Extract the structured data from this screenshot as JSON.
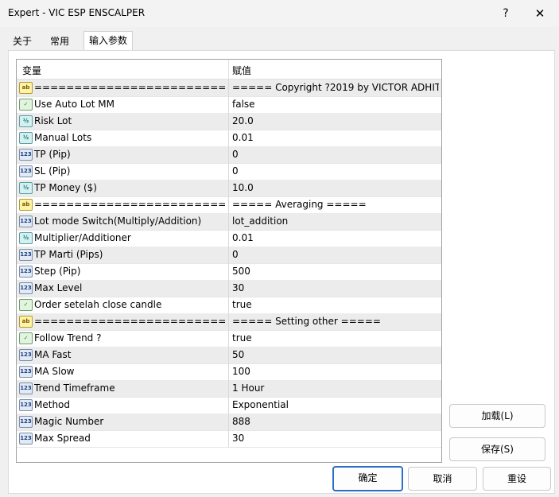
{
  "window": {
    "title": "Expert - VIC ESP ENSCALPER",
    "help_label": "?",
    "close_label": "✕"
  },
  "tabs": [
    {
      "label": "关于"
    },
    {
      "label": "常用"
    },
    {
      "label": "输入参数"
    }
  ],
  "grid": {
    "col_variable": "变量",
    "col_value": "赋值",
    "rows": [
      {
        "icon": "ab",
        "icon_name": "string-type-icon",
        "name": "=========================...",
        "value": "===== Copyright ?2019 by VICTOR ADHIT..."
      },
      {
        "icon": "bool",
        "icon_name": "boolean-type-icon",
        "name": "Use Auto Lot MM",
        "value": "false"
      },
      {
        "icon": "v2",
        "icon_name": "double-type-icon",
        "name": "Risk Lot",
        "value": "20.0"
      },
      {
        "icon": "v2",
        "icon_name": "double-type-icon",
        "name": "Manual Lots",
        "value": "0.01"
      },
      {
        "icon": "123",
        "icon_name": "integer-type-icon",
        "name": "TP (Pip)",
        "value": "0"
      },
      {
        "icon": "123",
        "icon_name": "integer-type-icon",
        "name": "SL (Pip)",
        "value": "0"
      },
      {
        "icon": "v2",
        "icon_name": "double-type-icon",
        "name": "TP Money ($)",
        "value": "10.0"
      },
      {
        "icon": "ab",
        "icon_name": "string-type-icon",
        "name": "=========================...",
        "value": "===== Averaging ====="
      },
      {
        "icon": "123",
        "icon_name": "integer-type-icon",
        "name": "Lot mode Switch(Multiply/Addition)",
        "value": "lot_addition"
      },
      {
        "icon": "v2",
        "icon_name": "double-type-icon",
        "name": "Multiplier/Additioner",
        "value": "0.01"
      },
      {
        "icon": "123",
        "icon_name": "integer-type-icon",
        "name": "TP Marti (Pips)",
        "value": "0"
      },
      {
        "icon": "123",
        "icon_name": "integer-type-icon",
        "name": "Step (Pip)",
        "value": "500"
      },
      {
        "icon": "123",
        "icon_name": "integer-type-icon",
        "name": "Max Level",
        "value": "30"
      },
      {
        "icon": "bool",
        "icon_name": "boolean-type-icon",
        "name": "Order setelah close candle",
        "value": "true"
      },
      {
        "icon": "ab",
        "icon_name": "string-type-icon",
        "name": "=========================...",
        "value": "===== Setting other ====="
      },
      {
        "icon": "bool",
        "icon_name": "boolean-type-icon",
        "name": "Follow Trend ?",
        "value": "true"
      },
      {
        "icon": "123",
        "icon_name": "integer-type-icon",
        "name": "MA Fast",
        "value": "50"
      },
      {
        "icon": "123",
        "icon_name": "integer-type-icon",
        "name": "MA Slow",
        "value": "100"
      },
      {
        "icon": "123",
        "icon_name": "integer-type-icon",
        "name": "Trend Timeframe",
        "value": "1 Hour"
      },
      {
        "icon": "123",
        "icon_name": "integer-type-icon",
        "name": "Method",
        "value": "Exponential"
      },
      {
        "icon": "123",
        "icon_name": "integer-type-icon",
        "name": "Magic Number",
        "value": "888"
      },
      {
        "icon": "123",
        "icon_name": "integer-type-icon",
        "name": "Max Spread",
        "value": "30"
      }
    ]
  },
  "buttons": {
    "load": "加载(L)",
    "save": "保存(S)",
    "ok": "确定",
    "cancel": "取消",
    "reset": "重设"
  }
}
